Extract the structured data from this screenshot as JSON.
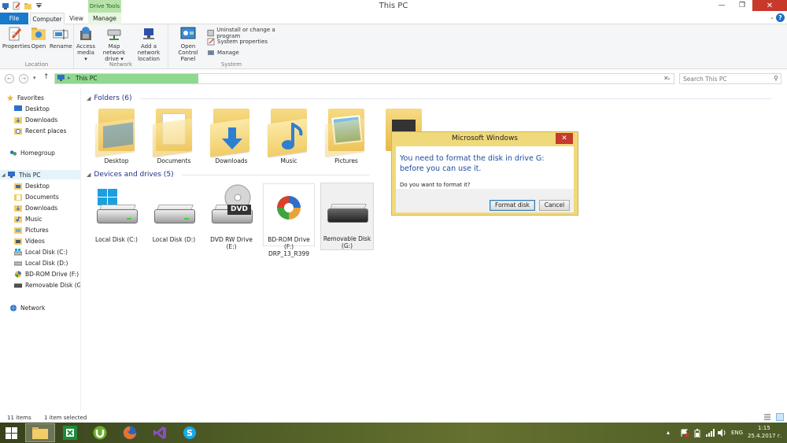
{
  "window": {
    "title": "This PC"
  },
  "ribbon": {
    "tabs": {
      "file": "File",
      "computer": "Computer",
      "view": "View",
      "manage": "Manage",
      "contextual_group": "Drive Tools"
    },
    "location_group": {
      "label": "Location",
      "properties": "Properties",
      "open": "Open",
      "rename": "Rename"
    },
    "network_group": {
      "label": "Network",
      "access_media": [
        "Access",
        "media"
      ],
      "map_network_drive": [
        "Map network",
        "drive"
      ],
      "add_network_location": [
        "Add a network",
        "location"
      ]
    },
    "system_group": {
      "label": "System",
      "open_control_panel": [
        "Open Control",
        "Panel"
      ],
      "uninstall": "Uninstall or change a program",
      "system_properties": "System properties",
      "manage": "Manage"
    }
  },
  "address": {
    "path": "This PC",
    "search_placeholder": "Search This PC"
  },
  "navpane": {
    "favorites": "Favorites",
    "fav_items": [
      "Desktop",
      "Downloads",
      "Recent places"
    ],
    "homegroup": "Homegroup",
    "this_pc": "This PC",
    "pc_items": [
      "Desktop",
      "Documents",
      "Downloads",
      "Music",
      "Pictures",
      "Videos",
      "Local Disk (C:)",
      "Local Disk (D:)",
      "BD-ROM Drive (F:) D",
      "Removable Disk (G:)"
    ],
    "network": "Network"
  },
  "content": {
    "folders_header": "Folders (6)",
    "folders": [
      "Desktop",
      "Documents",
      "Downloads",
      "Music",
      "Pictures"
    ],
    "drives_header": "Devices and drives (5)",
    "drives": [
      [
        "Local Disk (C:)"
      ],
      [
        "Local Disk (D:)"
      ],
      [
        "DVD RW Drive",
        "(E:)"
      ],
      [
        "BD-ROM Drive",
        "(F:) DRP_13_R399"
      ],
      [
        "Removable Disk",
        "(G:)"
      ]
    ],
    "dvd_badge": "DVD"
  },
  "dialog": {
    "title": "Microsoft Windows",
    "message": "You need to format the disk in drive G: before you can use it.",
    "question": "Do you want to format it?",
    "format_button": "Format disk",
    "cancel_button": "Cancel"
  },
  "status": {
    "item_count": "11 items",
    "selection": "1 item selected"
  },
  "taskbar": {
    "language": "ENG",
    "time": "1:15",
    "date": "25.4.2017 г."
  },
  "colors": {
    "accent": "#1979ca",
    "dialog_frame": "#f0d97a",
    "close_red": "#c7392b",
    "progress_green": "#8fd88f"
  }
}
